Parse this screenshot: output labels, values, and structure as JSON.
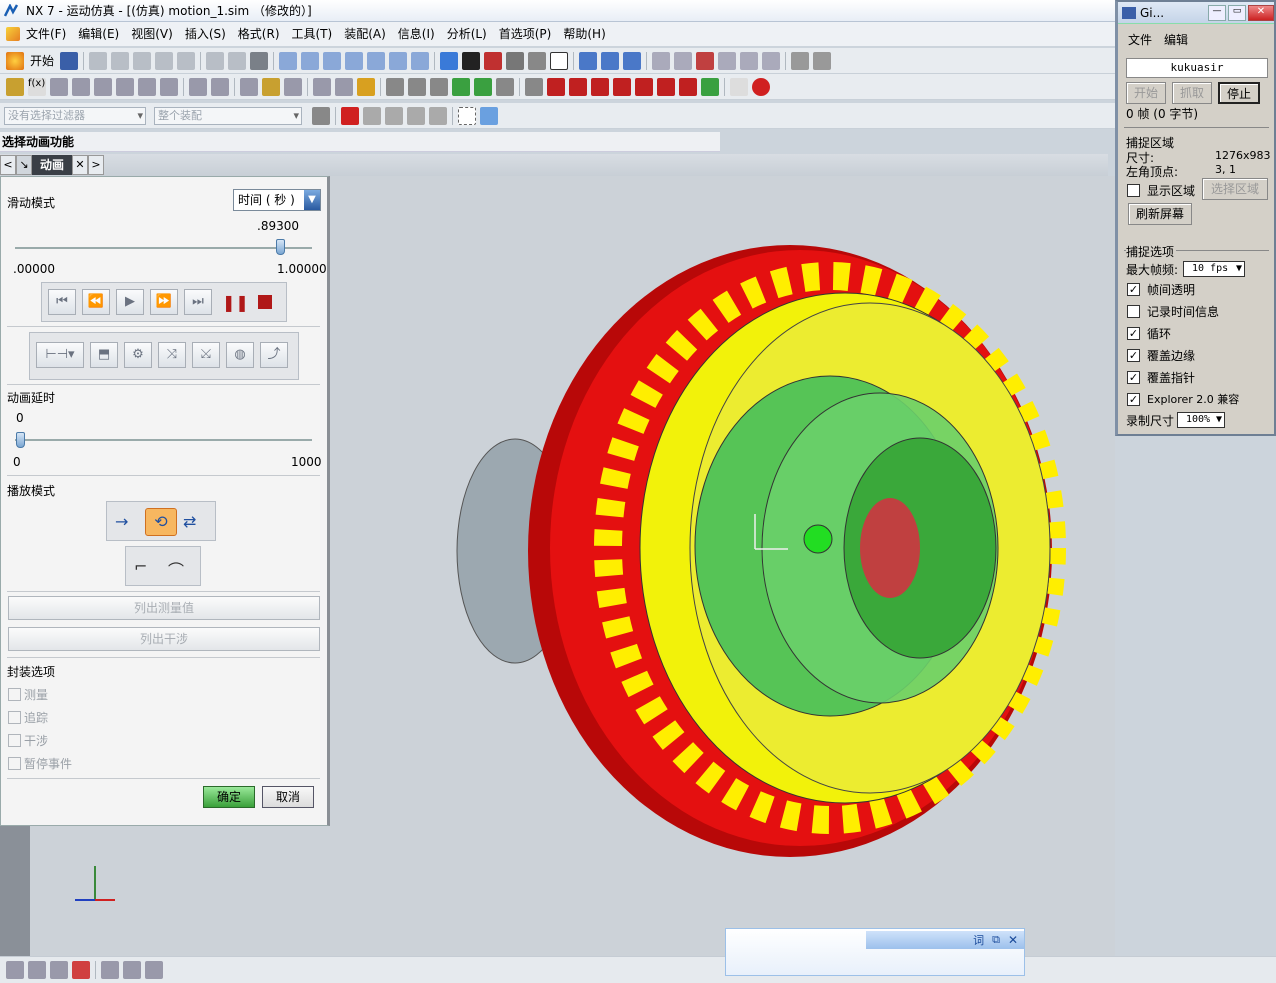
{
  "titlebar": {
    "title": "NX 7 - 运动仿真 - [(仿真) motion_1.sim （修改的）]"
  },
  "menubar": {
    "items": [
      "文件(F)",
      "编辑(E)",
      "视图(V)",
      "插入(S)",
      "格式(R)",
      "工具(T)",
      "装配(A)",
      "信息(I)",
      "分析(L)",
      "首选项(P)",
      "帮助(H)"
    ]
  },
  "toolbar1": {
    "start_label": "开始"
  },
  "toolbar3": {
    "filter_placeholder": "没有选择过滤器",
    "assembly_placeholder": "整个装配"
  },
  "panel": {
    "title": "选择动画功能",
    "tab_label": "动画",
    "tab_prev": "<",
    "tab_next": ">"
  },
  "dialog": {
    "slide_mode_label": "滑动模式",
    "slide_mode_value": "时间 ( 秒 )",
    "slider_value": ".89300",
    "slider_position": 0.893,
    "slider_min": ".00000",
    "slider_max": "1.00000",
    "delay_label": "动画延时",
    "delay_value": "0",
    "delay_min": "0",
    "delay_max": "1000",
    "delay_position": 0,
    "play_mode_label": "播放模式",
    "list_measure_label": "列出测量值",
    "list_interference_label": "列出干涉",
    "envelope_label": "封装选项",
    "envelope_options": [
      "测量",
      "追踪",
      "干涉",
      "暂停事件"
    ],
    "ok_label": "确定",
    "cancel_label": "取消"
  },
  "capture": {
    "title": "Gi...",
    "menu": [
      "文件",
      "编辑"
    ],
    "banner": "kukuasir",
    "start_label": "开始",
    "grab_label": "抓取",
    "stop_label": "停止",
    "frames_text": "0 帧 (0 字节)",
    "region_header": "捕捉区域",
    "size_label": "尺寸:",
    "size_value": "1276x983",
    "corner_label": "左角顶点:",
    "corner_value": "3, 1",
    "show_region_label": "显示区域",
    "select_region_label": "选择区域",
    "refresh_label": "刷新屏幕",
    "options_header": "捕捉选项",
    "fps_label": "最大帧频:",
    "fps_value": "10 fps",
    "options": [
      {
        "label": "帧间透明",
        "checked": true
      },
      {
        "label": "记录时间信息",
        "checked": false
      },
      {
        "label": "循环",
        "checked": true
      },
      {
        "label": "覆盖边缘",
        "checked": true
      },
      {
        "label": "覆盖指针",
        "checked": true
      },
      {
        "label": "Explorer 2.0 兼容",
        "checked": true
      }
    ],
    "record_size_label": "录制尺寸",
    "record_size_value": "100%"
  },
  "ime": {
    "label": "词"
  },
  "colors": {
    "gear_red": "#e01010",
    "gear_yellow": "#f2f20a",
    "gear_green": "#40c040",
    "accent_blue": "#2a6ab0"
  }
}
